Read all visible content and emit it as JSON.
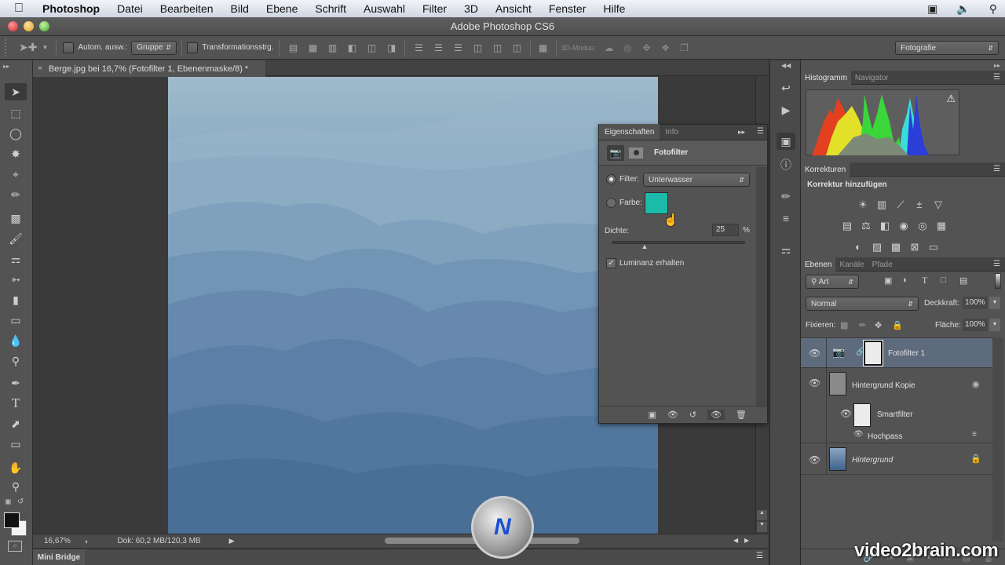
{
  "menubar": {
    "app": "Photoshop",
    "items": [
      "Datei",
      "Bearbeiten",
      "Bild",
      "Ebene",
      "Schrift",
      "Auswahl",
      "Filter",
      "3D",
      "Ansicht",
      "Fenster",
      "Hilfe"
    ],
    "status_icons": [
      "battery-icon",
      "volume-icon",
      "spotlight-search-icon"
    ]
  },
  "window": {
    "title": "Adobe Photoshop CS6"
  },
  "options": {
    "auto_select_label": "Autom. ausw.:",
    "auto_select_value": "Gruppe",
    "transform_label": "Transformationsstrg.",
    "mode3d_label": "3D-Modus:",
    "workspace": "Fotografie"
  },
  "document": {
    "tab_title": "Berge.jpg bei 16,7% (Fotofilter 1, Ebenenmaske/8) *",
    "zoom": "16,67%",
    "doc_info": "Dok: 60,2 MB/120,3 MB"
  },
  "minibridge": {
    "label": "Mini Bridge"
  },
  "properties": {
    "tabs": [
      "Eigenschaften",
      "Info"
    ],
    "active_tab": "Eigenschaften",
    "title": "Fotofilter",
    "filter_label": "Filter:",
    "filter_value": "Unterwasser",
    "color_label": "Farbe:",
    "color_value": "#1cbaa8",
    "density_label": "Dichte:",
    "density_value": "25",
    "density_unit": "%",
    "density_percent": 25,
    "luminance_label": "Luminanz erhalten",
    "luminance_checked": true,
    "filter_selected": true
  },
  "histogram": {
    "tabs": [
      "Histogramm",
      "Navigator"
    ],
    "active_tab": "Histogramm"
  },
  "adjustments": {
    "tab": "Korrekturen",
    "heading": "Korrektur hinzufügen",
    "row1": [
      "brightness-contrast-icon",
      "levels-icon",
      "curves-icon",
      "exposure-icon",
      "vibrance-icon"
    ],
    "row2": [
      "hue-saturation-icon",
      "color-balance-icon",
      "black-white-icon",
      "photo-filter-icon",
      "channel-mixer-icon",
      "color-lookup-icon"
    ],
    "row3": [
      "invert-icon",
      "posterize-icon",
      "threshold-icon",
      "selective-color-icon",
      "gradient-map-icon"
    ]
  },
  "layers_panel": {
    "tabs": [
      "Ebenen",
      "Kanäle",
      "Pfade"
    ],
    "active_tab": "Ebenen",
    "filter_kind": "Art",
    "blend_mode": "Normal",
    "opacity_label": "Deckkraft:",
    "opacity": "100%",
    "lock_label": "Fixieren:",
    "fill_label": "Fläche:",
    "fill": "100%",
    "layers": [
      {
        "name": "Fotofilter 1",
        "type": "adjustment",
        "selected": true
      },
      {
        "name": "Hintergrund Kopie",
        "type": "smart-object"
      },
      {
        "name": "Smartfilter",
        "type": "smart-filter-mask"
      },
      {
        "name": "Hochpass",
        "type": "smart-filter"
      },
      {
        "name": "Hintergrund",
        "type": "background",
        "locked": true
      }
    ]
  },
  "watermark": "video2brain.com"
}
